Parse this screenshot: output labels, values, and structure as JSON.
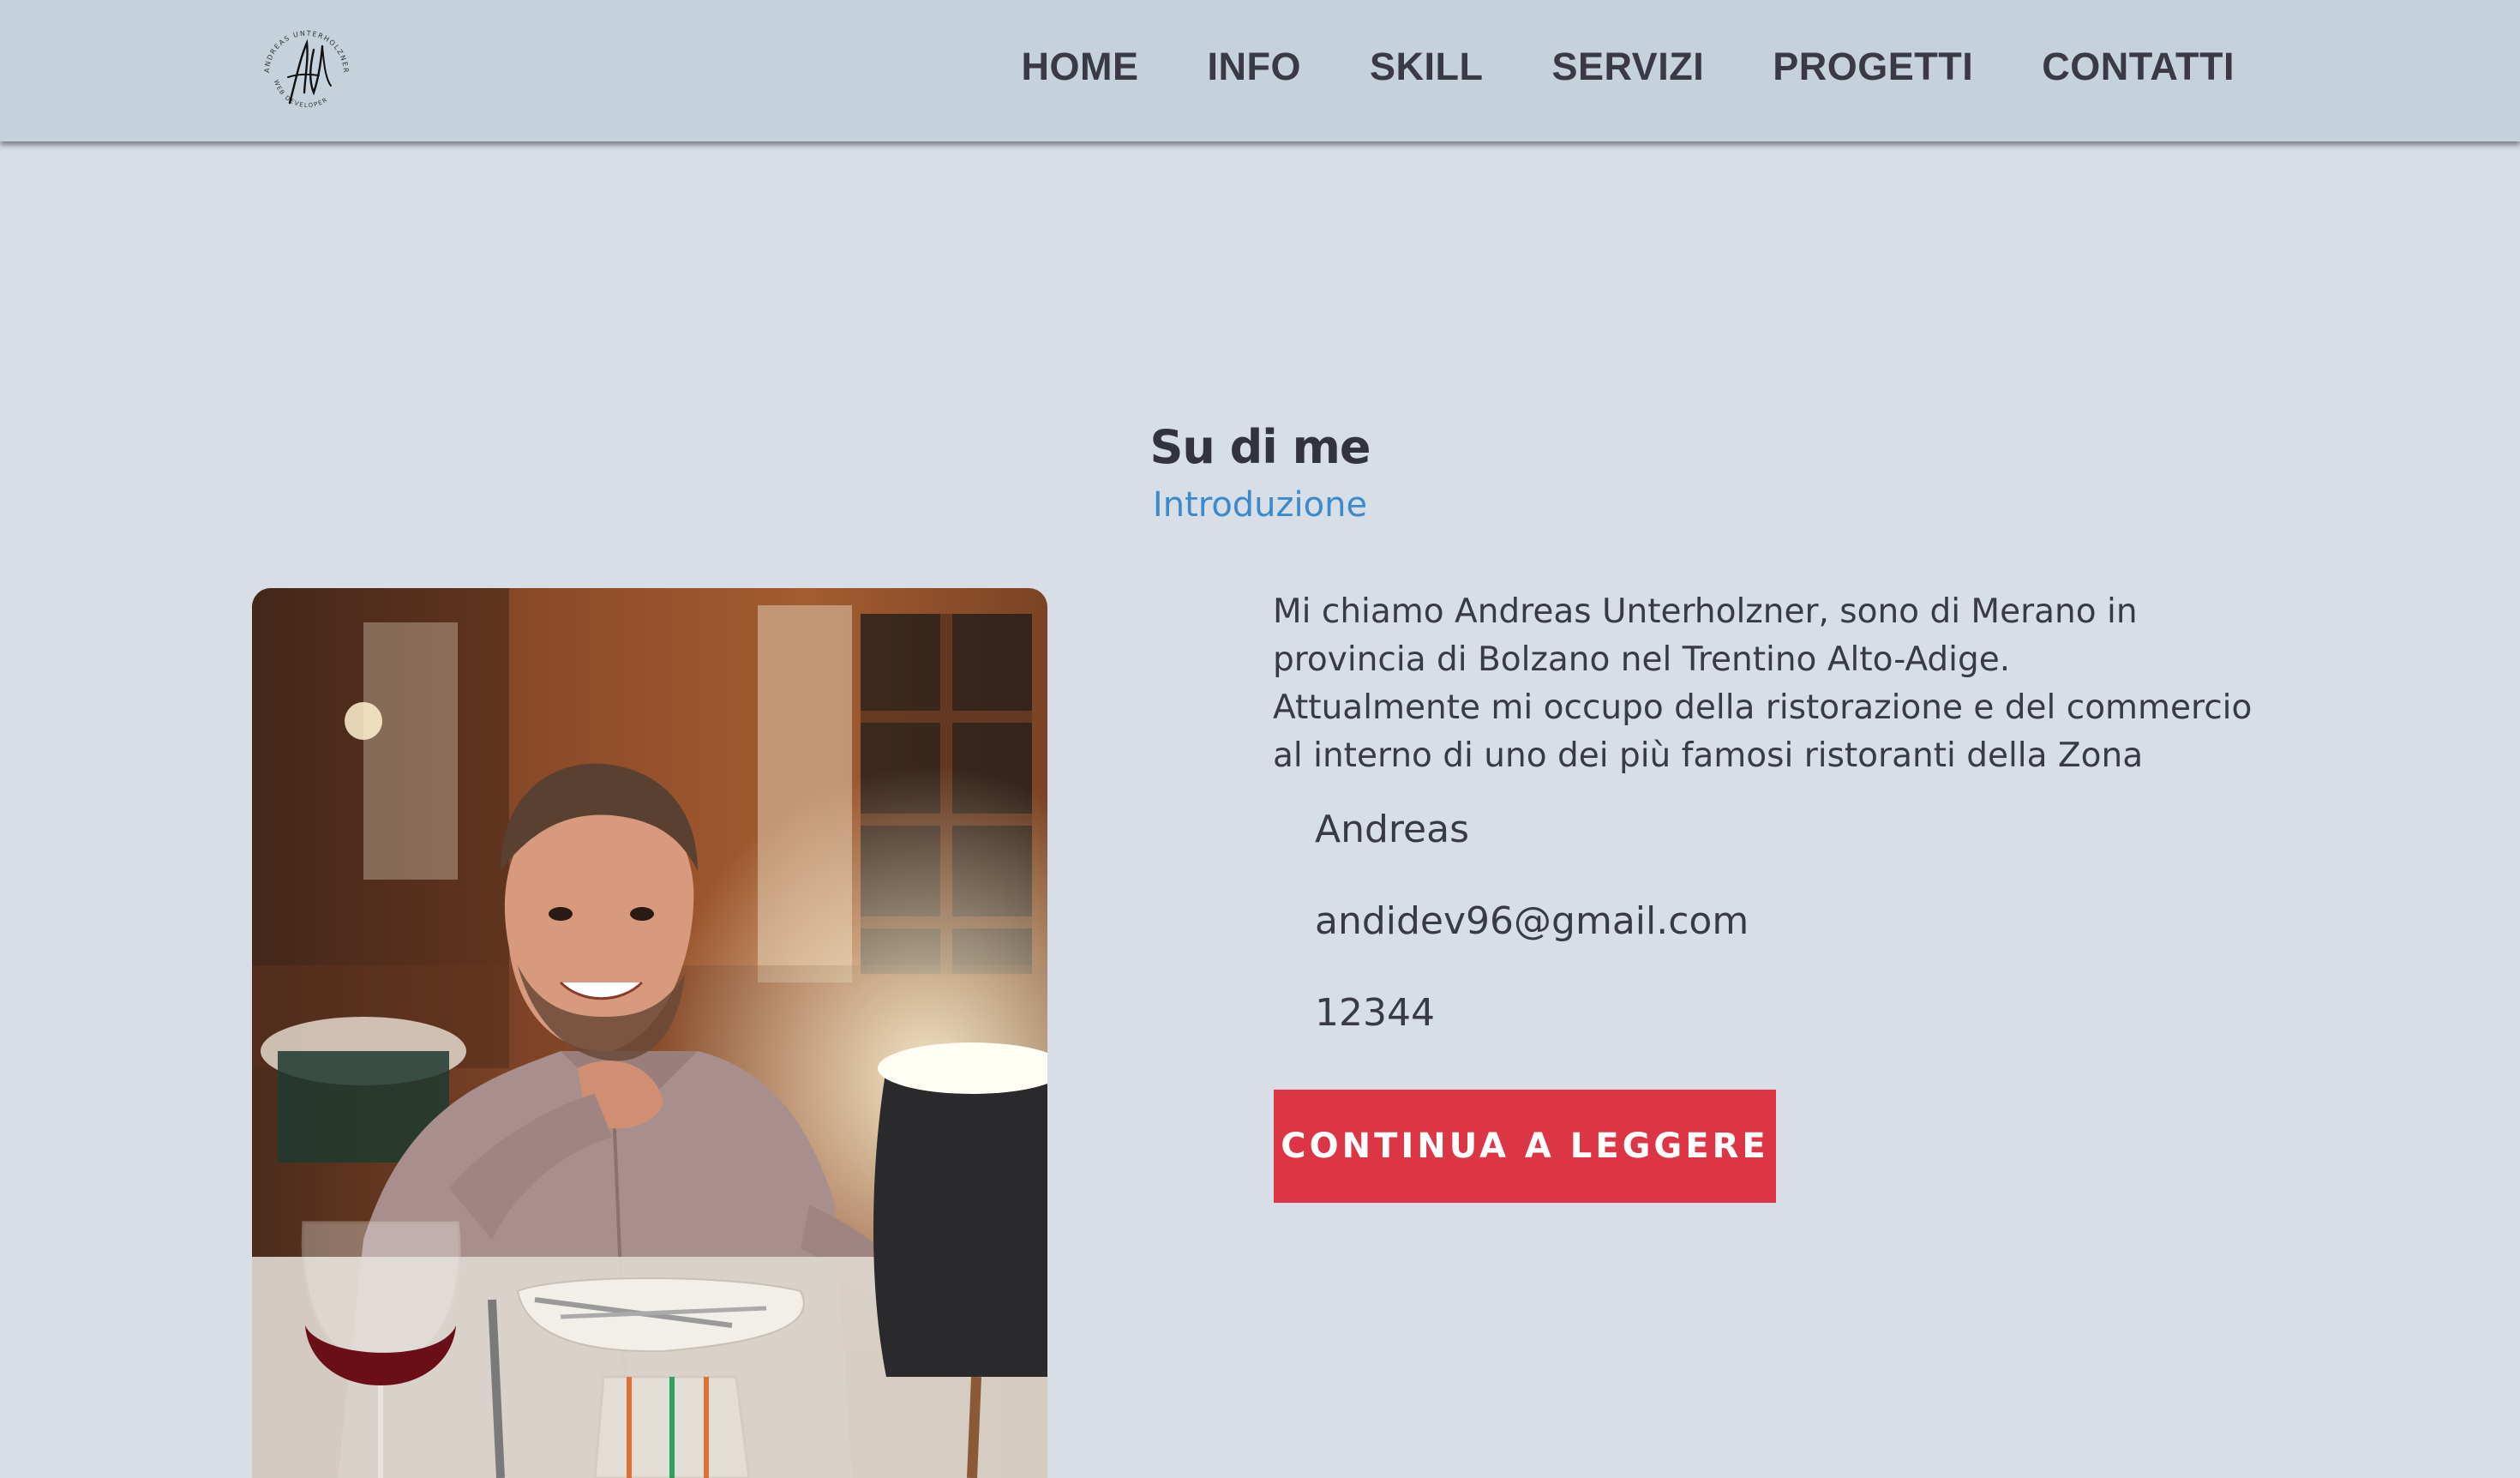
{
  "header": {
    "logo_icon": "signature-logo",
    "logo_ring_top": "ANDREAS UNTERHOLZNER",
    "logo_ring_bottom": "WEB DEVELOPER",
    "nav": [
      {
        "label": "HOME"
      },
      {
        "label": "INFO"
      },
      {
        "label": "SKILL"
      },
      {
        "label": "SERVIZI"
      },
      {
        "label": "PROGETTI"
      },
      {
        "label": "CONTATTI"
      }
    ]
  },
  "about": {
    "title": "Su di me",
    "subtitle": "Introduzione",
    "paragraph_1": "Mi chiamo Andreas Unterholzner, sono di Merano in provincia di Bolzano nel Trentino Alto-Adige.",
    "paragraph_2": "Attualmente mi occupo della ristorazione e del commercio al interno di uno dei più famosi ristoranti della Zona",
    "name": "Andreas",
    "email": "andidev96@gmail.com",
    "phone": "12344",
    "cta_label": "CONTINUA A LEGGERE"
  },
  "colors": {
    "background": "#d7dee6",
    "navbar": "#c5d2db",
    "accent_blue": "#3b8ad0",
    "button_red": "#dc3545",
    "text_dark": "#3a3a46"
  }
}
